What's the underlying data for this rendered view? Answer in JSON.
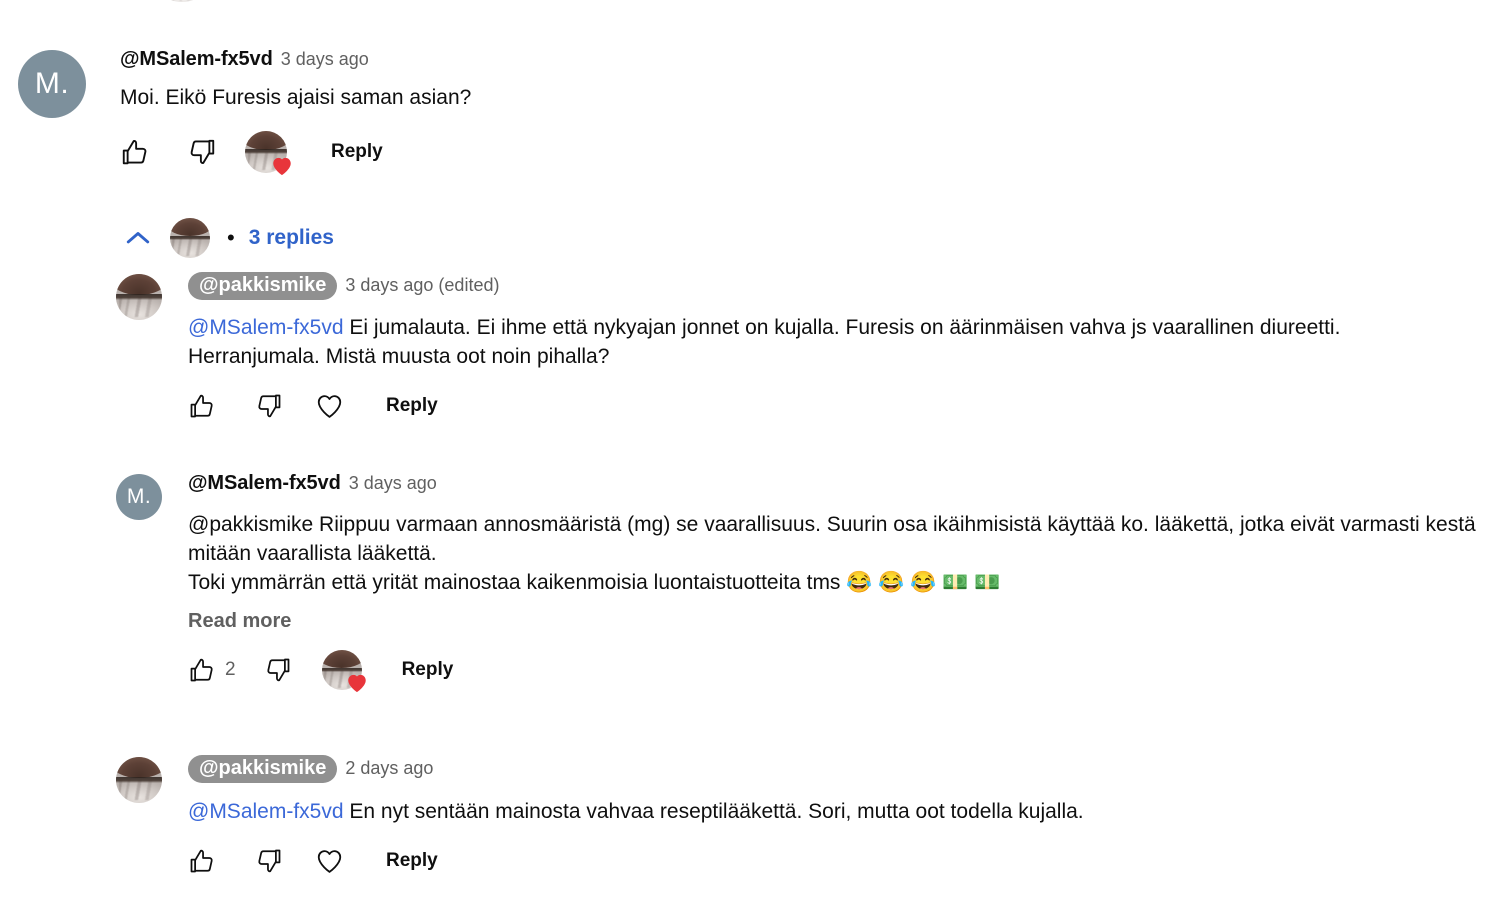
{
  "page": {
    "platform": "youtube-comments",
    "background_color": "#ffffff",
    "link_color": "#3b68d8",
    "replies_link_color": "#3063c9",
    "secondary_text_color": "#606060",
    "primary_text_color": "#0f0f0f",
    "owner_pill_color": "#909090",
    "heart_color": "#e8353b",
    "letter_avatar_color": "#7d909c"
  },
  "top_comment": {
    "avatar": {
      "type": "letter",
      "initials": "M."
    },
    "author": "@MSalem-fx5vd",
    "timestamp": "3 days ago",
    "text": "Moi. Eikö Furesis ajaisi saman asian?",
    "actions": {
      "like_icon": "thumbs-up-icon",
      "like_count": "",
      "dislike_icon": "thumbs-down-icon",
      "creator_heart_icon": "creator-heart-icon",
      "reply_label": "Reply"
    }
  },
  "replies_toggle": {
    "chevron_icon": "chevron-up-icon",
    "avatar": {
      "type": "photo"
    },
    "bullet": "•",
    "label": "3 replies"
  },
  "replies": [
    {
      "avatar": {
        "type": "photo"
      },
      "author": "@pakkismike",
      "author_is_owner_pill": true,
      "timestamp": "3 days ago (edited)",
      "mention": "@MSalem-fx5vd",
      "mention_style": "link",
      "text_lines": [
        "Ei jumalauta. Ei ihme että nykyajan jonnet on kujalla. Furesis on äärinmäisen vahva js vaarallinen",
        "diureetti. Herranjumala. Mistä muusta oot noin pihalla?"
      ],
      "read_more": "",
      "actions": {
        "like_icon": "thumbs-up-icon",
        "like_count": "",
        "dislike_icon": "thumbs-down-icon",
        "heart_icon": "heart-outline-icon",
        "reply_label": "Reply"
      }
    },
    {
      "avatar": {
        "type": "letter",
        "initials": "M."
      },
      "author": "@MSalem-fx5vd",
      "author_is_owner_pill": false,
      "timestamp": "3 days ago",
      "mention": "@pakkismike",
      "mention_style": "plain",
      "text_lines": [
        " Riippuu varmaan annosmääristä (mg) se vaarallisuus. Suurin osa ikäihmisistä käyttää ko. lääkettä,",
        "jotka eivät varmasti kestä mitään vaarallista lääkettä.",
        "Toki ymmärrän että yrität mainostaa kaikenmoisia luontaistuotteita tms 😂 😂 😂 💵 💵"
      ],
      "read_more": "Read more",
      "actions": {
        "like_icon": "thumbs-up-icon",
        "like_count": "2",
        "dislike_icon": "thumbs-down-icon",
        "creator_heart_icon": "creator-heart-icon",
        "reply_label": "Reply"
      }
    },
    {
      "avatar": {
        "type": "photo"
      },
      "author": "@pakkismike",
      "author_is_owner_pill": true,
      "timestamp": "2 days ago",
      "mention": "@MSalem-fx5vd",
      "mention_style": "link",
      "text_lines": [
        "En nyt sentään mainosta vahvaa reseptilääkettä. Sori, mutta oot todella kujalla."
      ],
      "read_more": "",
      "actions": {
        "like_icon": "thumbs-up-icon",
        "like_count": "",
        "dislike_icon": "thumbs-down-icon",
        "heart_icon": "heart-outline-icon",
        "reply_label": "Reply"
      }
    }
  ]
}
